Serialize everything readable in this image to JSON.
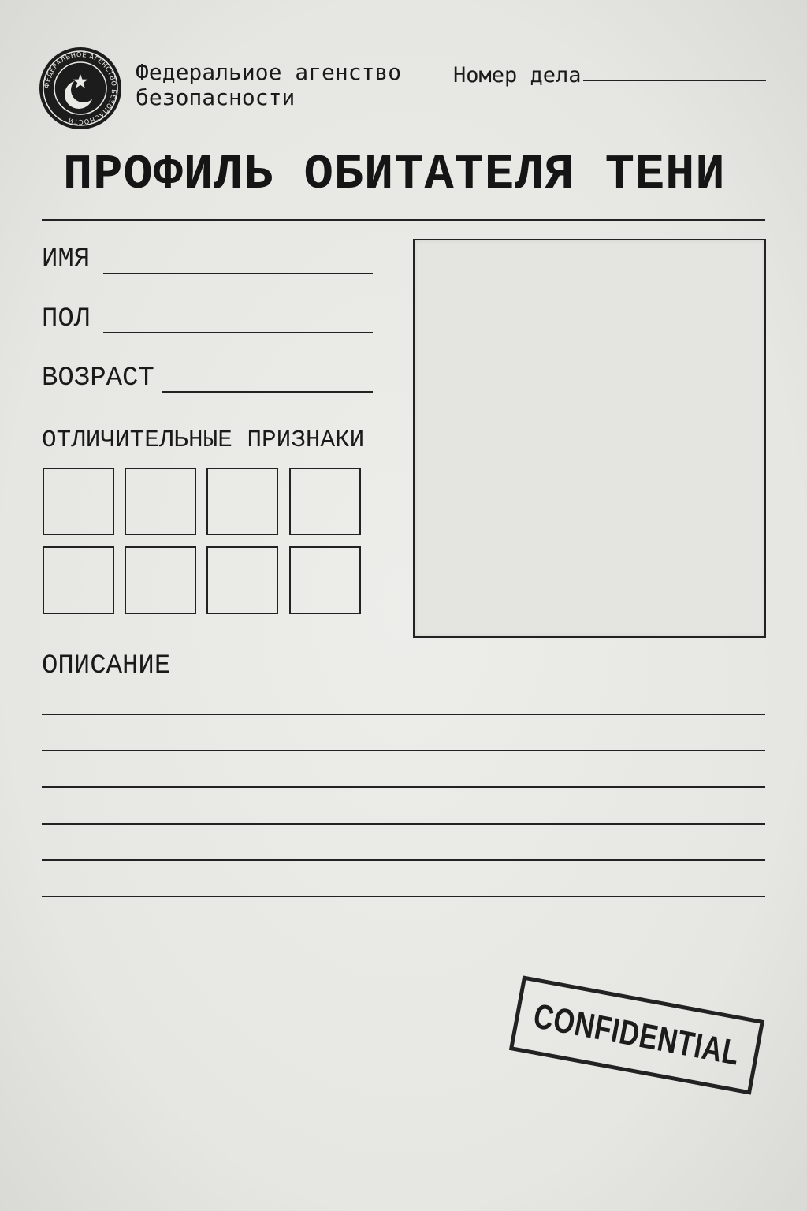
{
  "header": {
    "seal_icon": "agency-seal-icon",
    "seal_ring_text": "ФЕДЕРАЛЬНОЕ АГЕНСТВО БЕЗОПАСНОСТИ",
    "agency_line1": "Федеральиое агенство",
    "agency_line2": "безопасности",
    "case_number_label": "Номер дела",
    "case_number_value": ""
  },
  "title": "ПРОФИЛЬ ОБИТАТЕЛЯ ТЕНИ",
  "fields": {
    "name_label": "ИМЯ",
    "name_value": "",
    "gender_label": "ПОЛ",
    "gender_value": "",
    "age_label": "ВОЗРАСТ",
    "age_value": ""
  },
  "distinguishing_marks": {
    "label": "ОТЛИЧИТЕЛЬНЫЕ ПРИЗНАКИ",
    "boxes": [
      "",
      "",
      "",
      "",
      "",
      "",
      "",
      ""
    ]
  },
  "photo": {
    "placeholder": ""
  },
  "description": {
    "label": "ОПИСАНИЕ",
    "lines": [
      "",
      "",
      "",
      "",
      "",
      ""
    ]
  },
  "stamp": {
    "text": "CONFIDENTIAL"
  },
  "colors": {
    "paper": "#e9e9e6",
    "ink": "#1a1a1a"
  }
}
